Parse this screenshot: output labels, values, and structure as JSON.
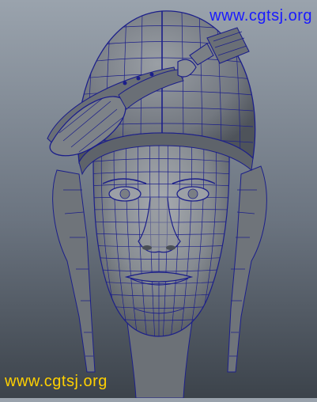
{
  "watermark": {
    "top": "www.cgtsj.org",
    "bottom": "www.cgtsj.org",
    "top_color": "#1a1aff",
    "bottom_color": "#ffd000"
  },
  "scene": {
    "subject_icon": "wireframe-head-model",
    "wire_color": "#1c1f8a",
    "shade_color": "#8a8f95"
  }
}
